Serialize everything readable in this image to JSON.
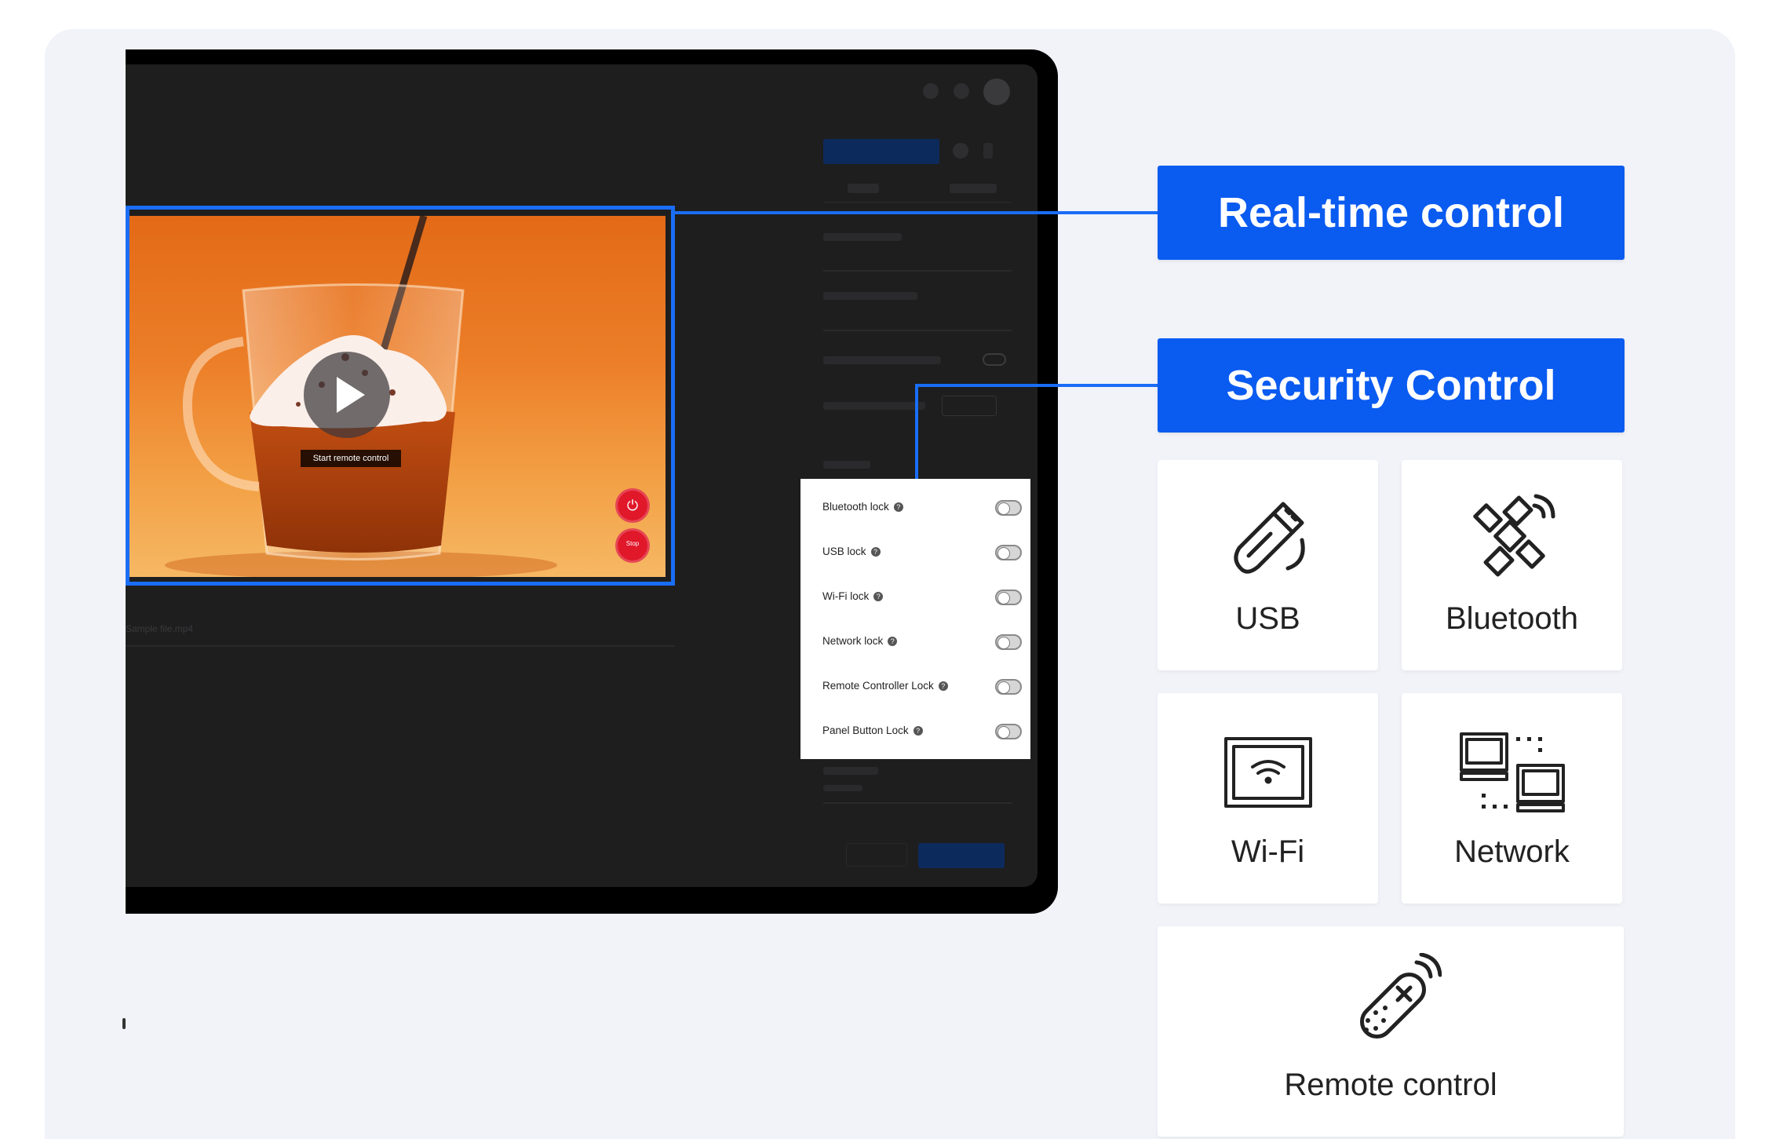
{
  "callouts": {
    "realtime": "Real-time control",
    "security": "Security Control"
  },
  "video": {
    "remote_label": "Start remote control",
    "stop_button_label": "Stop",
    "file_name": "Sample file.mp4"
  },
  "lock_panel": {
    "items": [
      {
        "label": "Bluetooth lock"
      },
      {
        "label": "USB lock"
      },
      {
        "label": "Wi-Fi lock"
      },
      {
        "label": "Network lock"
      },
      {
        "label": "Remote Controller Lock"
      },
      {
        "label": "Panel Button Lock"
      }
    ]
  },
  "features": [
    {
      "label": "USB",
      "icon": "usb-stick-icon"
    },
    {
      "label": "Bluetooth",
      "icon": "bluetooth-satellite-icon"
    },
    {
      "label": "Wi-Fi",
      "icon": "wifi-display-icon"
    },
    {
      "label": "Network",
      "icon": "network-computers-icon"
    },
    {
      "label": "Remote control",
      "icon": "remote-controller-icon"
    }
  ],
  "colors": {
    "accent_blue": "#0a5bf0",
    "frame_blue": "#1a6df5",
    "panel_bg": "#f1f3f9",
    "tablet_screen": "#1e1e1f",
    "stop_red": "#e0182a"
  }
}
